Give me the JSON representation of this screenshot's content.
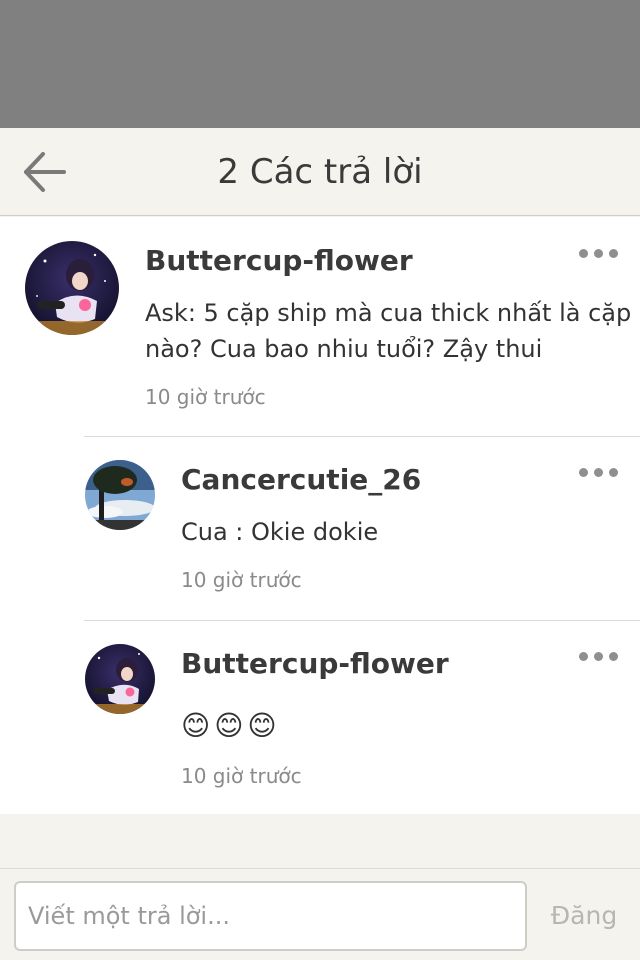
{
  "header": {
    "title": "2 Các trả lời",
    "back_icon": "arrow-left-icon"
  },
  "thread": {
    "original": {
      "username": "Buttercup-flower",
      "text_line1": "Ask: 5 cặp ship mà cua thick nhất là cặp",
      "text_line2": "nào? Cua bao nhiu tuổi? Zậy thui",
      "time": "10 giờ trước",
      "more_icon": "more-dots-icon"
    },
    "replies": [
      {
        "username": "Cancercutie_26",
        "text": "Cua : Okie dokie",
        "time": "10 giờ trước",
        "more_icon": "more-dots-icon"
      },
      {
        "username": "Buttercup-flower",
        "emoji": [
          "😊",
          "😊",
          "😊"
        ],
        "time": "10 giờ trước",
        "more_icon": "more-dots-icon"
      }
    ]
  },
  "composer": {
    "placeholder": "Viết một trả lời...",
    "value": "",
    "post_label": "Đăng"
  }
}
